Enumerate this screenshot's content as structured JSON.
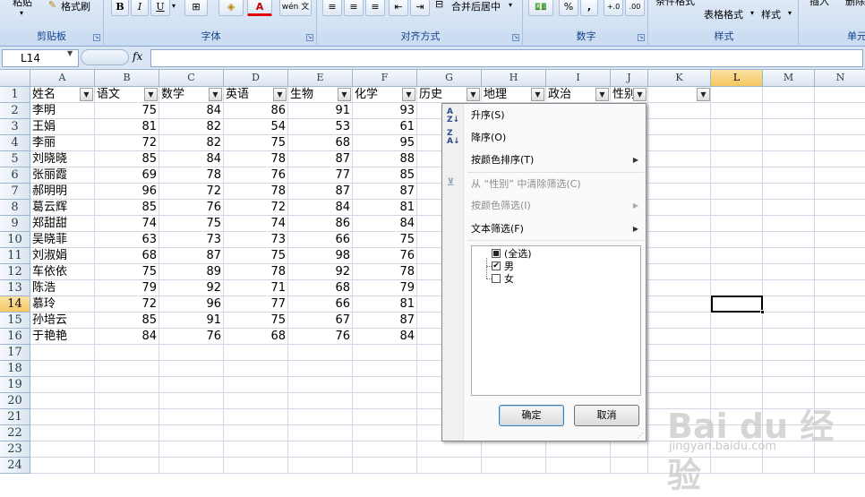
{
  "ribbon": {
    "clipboard": {
      "label": "剪贴板",
      "paste": "粘贴",
      "format_painter": "格式刷"
    },
    "font": {
      "label": "字体",
      "bold": "B",
      "italic": "I",
      "underline": "U",
      "phonetic": "wén 文",
      "font_color_glyph": "A"
    },
    "alignment": {
      "label": "对齐方式",
      "merge_center": "合并后居中"
    },
    "number": {
      "label": "数字",
      "percent": "%",
      "comma": ","
    },
    "styles": {
      "label": "样式",
      "conditional": "条件格式",
      "table_format": "表格格式",
      "cell_style": "样式"
    },
    "cells": {
      "label": "单元",
      "insert": "插入",
      "delete": "删除"
    }
  },
  "formula_bar": {
    "name_box": "L14",
    "fx": "fx",
    "value": ""
  },
  "columns": [
    "A",
    "B",
    "C",
    "D",
    "E",
    "F",
    "G",
    "H",
    "I",
    "J",
    "K",
    "L",
    "M",
    "N"
  ],
  "selected_column": "L",
  "selected_row": "14",
  "rows": [
    "1",
    "2",
    "3",
    "4",
    "5",
    "6",
    "7",
    "8",
    "9",
    "10",
    "11",
    "12",
    "13",
    "14",
    "15",
    "16",
    "17",
    "18",
    "19",
    "20",
    "21",
    "22",
    "23",
    "24"
  ],
  "headers": [
    "姓名",
    "语文",
    "数学",
    "英语",
    "生物",
    "化学",
    "历史",
    "地理",
    "政治",
    "性别"
  ],
  "data": [
    [
      "李明",
      "75",
      "84",
      "86",
      "91",
      "93"
    ],
    [
      "王娟",
      "81",
      "82",
      "54",
      "53",
      "61"
    ],
    [
      "李丽",
      "72",
      "82",
      "75",
      "68",
      "95"
    ],
    [
      "刘晓晓",
      "85",
      "84",
      "78",
      "87",
      "88"
    ],
    [
      "张丽霞",
      "69",
      "78",
      "76",
      "77",
      "85"
    ],
    [
      "郝明明",
      "96",
      "72",
      "78",
      "87",
      "87"
    ],
    [
      "葛云辉",
      "85",
      "76",
      "72",
      "84",
      "81"
    ],
    [
      "郑甜甜",
      "74",
      "75",
      "74",
      "86",
      "84"
    ],
    [
      "吴晓菲",
      "63",
      "73",
      "73",
      "66",
      "75"
    ],
    [
      "刘淑娟",
      "68",
      "87",
      "75",
      "98",
      "76"
    ],
    [
      "车依依",
      "75",
      "89",
      "78",
      "92",
      "78"
    ],
    [
      "陈浩",
      "79",
      "92",
      "71",
      "68",
      "79"
    ],
    [
      "慕玲",
      "72",
      "96",
      "77",
      "66",
      "81"
    ],
    [
      "孙培云",
      "85",
      "91",
      "75",
      "67",
      "87"
    ],
    [
      "于艳艳",
      "84",
      "76",
      "68",
      "76",
      "84"
    ]
  ],
  "filter_menu": {
    "sort_asc": "升序(S)",
    "sort_desc": "降序(O)",
    "sort_by_color": "按颜色排序(T)",
    "clear_filter": "从 “性别” 中清除筛选(C)",
    "filter_by_color": "按颜色筛选(I)",
    "text_filter": "文本筛选(F)",
    "items": [
      {
        "label": "(全选)",
        "state": "partial"
      },
      {
        "label": "男",
        "state": "checked"
      },
      {
        "label": "女",
        "state": "unchecked"
      }
    ],
    "ok": "确定",
    "cancel": "取消"
  },
  "watermark": {
    "text": "Bai du 经验",
    "sub": "jingyan.baidu.com"
  },
  "colors": {
    "header_bg": "#dbe5f1",
    "selected_header": "#f6c660",
    "ribbon_label": "#15428b",
    "grid_line": "#d0d7e5"
  }
}
